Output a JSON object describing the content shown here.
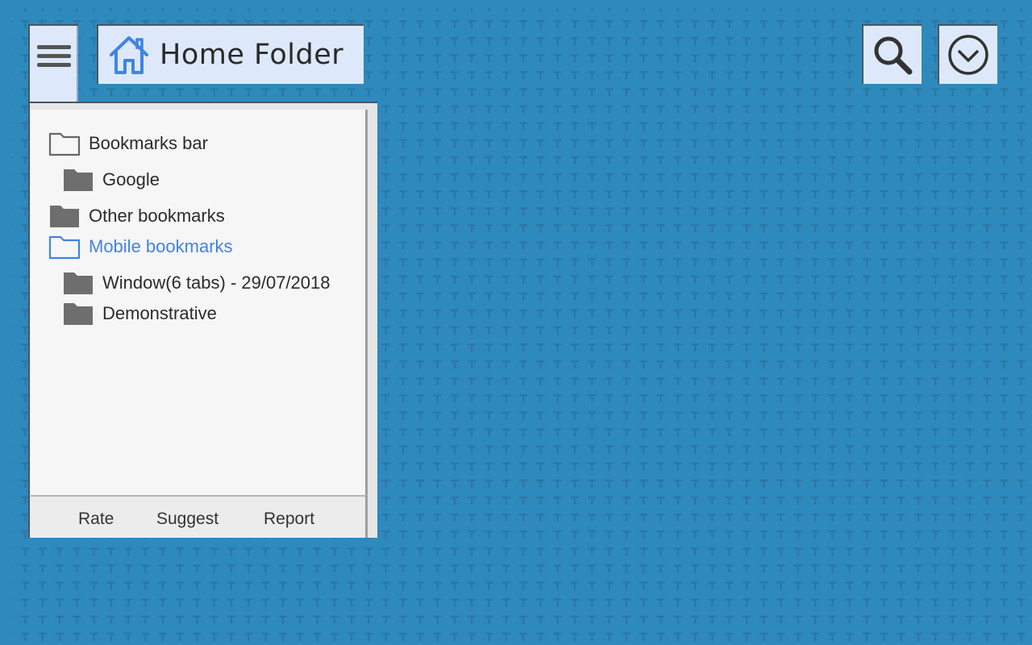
{
  "header": {
    "title": "Home Folder"
  },
  "icons": {
    "menu": "hamburger-icon",
    "home": "home-icon",
    "search": "search-icon",
    "dropdown": "chevron-down-circle-icon"
  },
  "colors": {
    "background": "#2e89bd",
    "accent": "#3f84e5",
    "panel": "#f6f6f6",
    "button": "#dde9fb"
  },
  "tree": {
    "items": [
      {
        "label": "Bookmarks bar",
        "type": "folder-open"
      },
      {
        "label": "Google",
        "type": "folder"
      },
      {
        "label": "Other bookmarks",
        "type": "folder"
      },
      {
        "label": "Mobile bookmarks",
        "type": "folder-open",
        "selected": true
      },
      {
        "label": "Window(6 tabs) - 29/07/2018",
        "type": "folder"
      },
      {
        "label": "Demonstrative",
        "type": "folder"
      }
    ]
  },
  "footer": {
    "rate": "Rate",
    "suggest": "Suggest",
    "report": "Report"
  }
}
